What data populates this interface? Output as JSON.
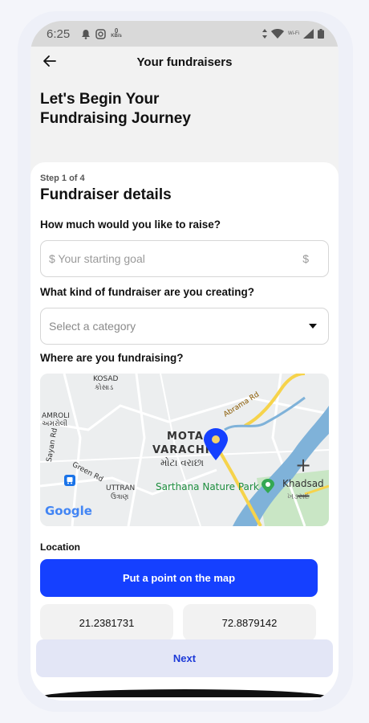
{
  "status_bar": {
    "time": "6:25",
    "net_speed_value": "0",
    "net_speed_unit": "KB/s",
    "wifi_label": "Wi-Fi"
  },
  "header": {
    "title": "Your fundraisers"
  },
  "hero": {
    "line1": "Let's Begin Your",
    "line2": "Fundraising Journey"
  },
  "form": {
    "step_label": "Step 1 of 4",
    "section_title": "Fundraiser details",
    "goal": {
      "question": "How much would you like to raise?",
      "placeholder": "$ Your starting goal",
      "suffix": "$"
    },
    "category": {
      "question": "What kind of fundraiser are you creating?",
      "placeholder": "Select a category"
    },
    "location": {
      "question": "Where are you fundraising?",
      "label": "Location",
      "button_label": "Put a point on the map",
      "latitude": "21.2381731",
      "longitude": "72.8879142"
    },
    "next_label": "Next"
  },
  "map": {
    "labels": {
      "kosad": "KOSAD",
      "kosad_gu": "કોસાડ",
      "amroli": "AMROLI",
      "amroli_gu": "અમરોલી",
      "sayan_rd": "Sayan Rd",
      "abrama_rd": "Abrama Rd",
      "mota": "MOTA",
      "varachha": "VARACHH",
      "mota_varachha_gu": "મોટા વરાછા",
      "green_rd": "Green Rd",
      "uttran": "UTTRAN",
      "uttran_gu": "ઉત્રાણ",
      "sarthana_park": "Sarthana Nature Park",
      "khadsad": "Khadsad",
      "khadsad_gu": "ખડસદ",
      "google": "Google",
      "zoom_in": "+",
      "zoom_out": "−"
    },
    "colors": {
      "river": "#7fb2d9",
      "road": "#f6d34b",
      "park": "#c9e6c5",
      "pin": "#1540ff"
    }
  },
  "colors": {
    "primary": "#1540ff",
    "secondary_bg": "#e3e6f6",
    "secondary_text": "#1d3ad8"
  }
}
